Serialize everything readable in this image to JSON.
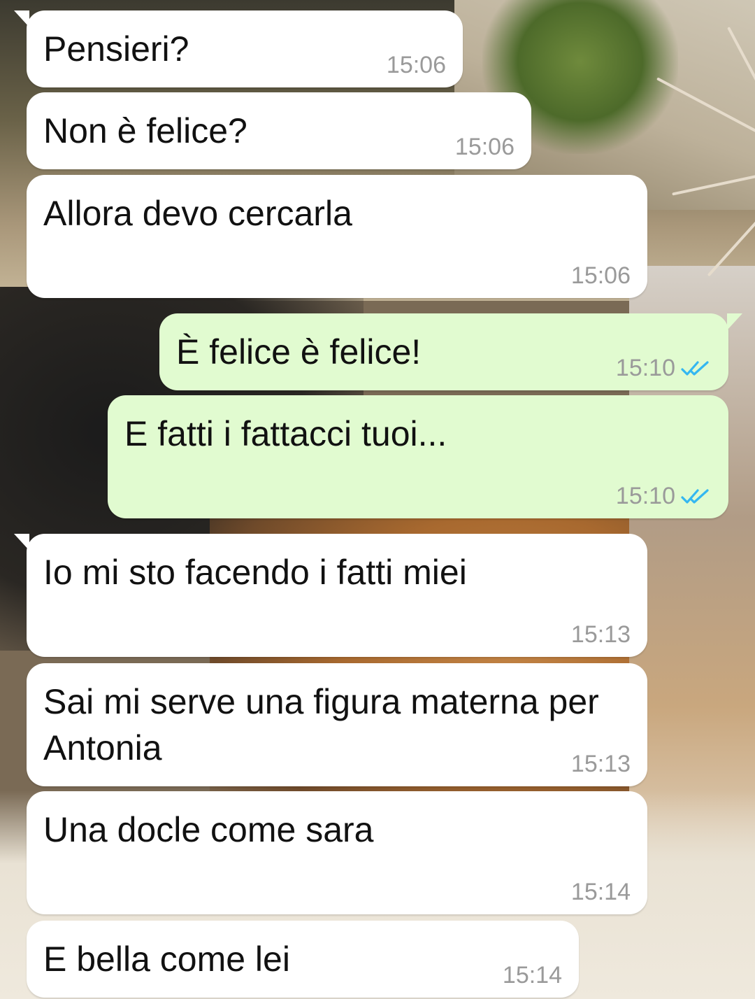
{
  "messages": [
    {
      "direction": "in",
      "text": "Pensieri?",
      "time": "15:06",
      "tail": true
    },
    {
      "direction": "in",
      "text": "Non è felice?",
      "time": "15:06",
      "tail": false
    },
    {
      "direction": "in",
      "text": "Allora devo cercarla",
      "time": "15:06",
      "tail": false
    },
    {
      "direction": "out",
      "text": "È felice è felice!",
      "time": "15:10",
      "tail": true,
      "status": "read"
    },
    {
      "direction": "out",
      "text": "E fatti i fattacci tuoi...",
      "time": "15:10",
      "tail": false,
      "status": "read"
    },
    {
      "direction": "in",
      "text": "Io mi sto facendo i fatti miei",
      "time": "15:13",
      "tail": true
    },
    {
      "direction": "in",
      "text": "Sai mi serve una figura materna per Antonia",
      "time": "15:13",
      "tail": false
    },
    {
      "direction": "in",
      "text": "Una docle come sara",
      "time": "15:14",
      "tail": false
    },
    {
      "direction": "in",
      "text": "E bella come lei",
      "time": "15:14",
      "tail": false
    }
  ],
  "colors": {
    "incoming_bubble": "#ffffff",
    "outgoing_bubble": "#e1fbd0",
    "timestamp": "#9a9a9a",
    "read_ticks": "#34b7f1"
  },
  "icons": {
    "read_receipt": "double-check-icon"
  }
}
